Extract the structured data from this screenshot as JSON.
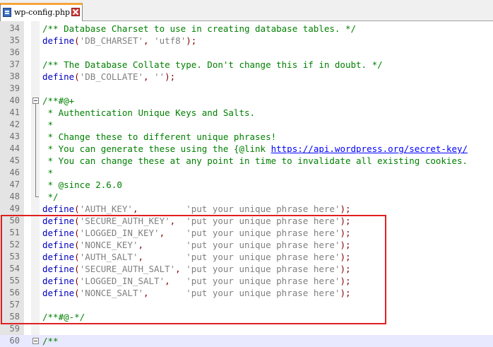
{
  "tab": {
    "filename": "wp-config.php"
  },
  "colors": {
    "highlight_box": "#e02020",
    "tab_accent": "#f6a43a"
  },
  "lines": [
    {
      "n": "34",
      "tokens": [
        {
          "t": "/** Database Charset to use in creating database tables. */",
          "c": "comment"
        }
      ]
    },
    {
      "n": "35",
      "tokens": [
        {
          "t": "define",
          "c": "kw"
        },
        {
          "t": "(",
          "c": "punc"
        },
        {
          "t": "'DB_CHARSET'",
          "c": "str"
        },
        {
          "t": ", ",
          "c": "punc"
        },
        {
          "t": "'utf8'",
          "c": "str"
        },
        {
          "t": ");",
          "c": "punc"
        }
      ]
    },
    {
      "n": "36",
      "tokens": []
    },
    {
      "n": "37",
      "tokens": [
        {
          "t": "/** The Database Collate type. Don't change this if in doubt. */",
          "c": "comment"
        }
      ]
    },
    {
      "n": "38",
      "tokens": [
        {
          "t": "define",
          "c": "kw"
        },
        {
          "t": "(",
          "c": "punc"
        },
        {
          "t": "'DB_COLLATE'",
          "c": "str"
        },
        {
          "t": ", ",
          "c": "punc"
        },
        {
          "t": "''",
          "c": "str"
        },
        {
          "t": ");",
          "c": "punc"
        }
      ]
    },
    {
      "n": "39",
      "tokens": []
    },
    {
      "n": "40",
      "tokens": [
        {
          "t": "/**#@+",
          "c": "comment"
        }
      ]
    },
    {
      "n": "41",
      "tokens": [
        {
          "t": " * Authentication Unique Keys and Salts.",
          "c": "comment"
        }
      ]
    },
    {
      "n": "42",
      "tokens": [
        {
          "t": " *",
          "c": "comment"
        }
      ]
    },
    {
      "n": "43",
      "tokens": [
        {
          "t": " * Change these to different unique phrases!",
          "c": "comment"
        }
      ]
    },
    {
      "n": "44",
      "tokens": [
        {
          "t": " * You can generate these using the {@link ",
          "c": "comment"
        },
        {
          "t": "https://api.wordpress.org/secret-key/",
          "c": "link"
        }
      ]
    },
    {
      "n": "45",
      "tokens": [
        {
          "t": " * You can change these at any point in time to invalidate all existing cookies.",
          "c": "comment"
        }
      ]
    },
    {
      "n": "46",
      "tokens": [
        {
          "t": " *",
          "c": "comment"
        }
      ]
    },
    {
      "n": "47",
      "tokens": [
        {
          "t": " * ",
          "c": "comment"
        },
        {
          "t": "@since",
          "c": "comment"
        },
        {
          "t": " 2.6.0",
          "c": "comment"
        }
      ]
    },
    {
      "n": "48",
      "tokens": [
        {
          "t": " */",
          "c": "comment"
        }
      ]
    },
    {
      "n": "49",
      "tokens": [
        {
          "t": "define",
          "c": "kw"
        },
        {
          "t": "(",
          "c": "punc"
        },
        {
          "t": "'AUTH_KEY'",
          "c": "str"
        },
        {
          "t": ",         ",
          "c": "punc"
        },
        {
          "t": "'put your unique phrase here'",
          "c": "str"
        },
        {
          "t": ");",
          "c": "punc"
        }
      ]
    },
    {
      "n": "50",
      "tokens": [
        {
          "t": "define",
          "c": "kw"
        },
        {
          "t": "(",
          "c": "punc"
        },
        {
          "t": "'SECURE_AUTH_KEY'",
          "c": "str"
        },
        {
          "t": ",  ",
          "c": "punc"
        },
        {
          "t": "'put your unique phrase here'",
          "c": "str"
        },
        {
          "t": ");",
          "c": "punc"
        }
      ]
    },
    {
      "n": "51",
      "tokens": [
        {
          "t": "define",
          "c": "kw"
        },
        {
          "t": "(",
          "c": "punc"
        },
        {
          "t": "'LOGGED_IN_KEY'",
          "c": "str"
        },
        {
          "t": ",    ",
          "c": "punc"
        },
        {
          "t": "'put your unique phrase here'",
          "c": "str"
        },
        {
          "t": ");",
          "c": "punc"
        }
      ]
    },
    {
      "n": "52",
      "tokens": [
        {
          "t": "define",
          "c": "kw"
        },
        {
          "t": "(",
          "c": "punc"
        },
        {
          "t": "'NONCE_KEY'",
          "c": "str"
        },
        {
          "t": ",        ",
          "c": "punc"
        },
        {
          "t": "'put your unique phrase here'",
          "c": "str"
        },
        {
          "t": ");",
          "c": "punc"
        }
      ]
    },
    {
      "n": "53",
      "tokens": [
        {
          "t": "define",
          "c": "kw"
        },
        {
          "t": "(",
          "c": "punc"
        },
        {
          "t": "'AUTH_SALT'",
          "c": "str"
        },
        {
          "t": ",        ",
          "c": "punc"
        },
        {
          "t": "'put your unique phrase here'",
          "c": "str"
        },
        {
          "t": ");",
          "c": "punc"
        }
      ]
    },
    {
      "n": "54",
      "tokens": [
        {
          "t": "define",
          "c": "kw"
        },
        {
          "t": "(",
          "c": "punc"
        },
        {
          "t": "'SECURE_AUTH_SALT'",
          "c": "str"
        },
        {
          "t": ", ",
          "c": "punc"
        },
        {
          "t": "'put your unique phrase here'",
          "c": "str"
        },
        {
          "t": ");",
          "c": "punc"
        }
      ]
    },
    {
      "n": "55",
      "tokens": [
        {
          "t": "define",
          "c": "kw"
        },
        {
          "t": "(",
          "c": "punc"
        },
        {
          "t": "'LOGGED_IN_SALT'",
          "c": "str"
        },
        {
          "t": ",   ",
          "c": "punc"
        },
        {
          "t": "'put your unique phrase here'",
          "c": "str"
        },
        {
          "t": ");",
          "c": "punc"
        }
      ]
    },
    {
      "n": "56",
      "tokens": [
        {
          "t": "define",
          "c": "kw"
        },
        {
          "t": "(",
          "c": "punc"
        },
        {
          "t": "'NONCE_SALT'",
          "c": "str"
        },
        {
          "t": ",       ",
          "c": "punc"
        },
        {
          "t": "'put your unique phrase here'",
          "c": "str"
        },
        {
          "t": ");",
          "c": "punc"
        }
      ]
    },
    {
      "n": "57",
      "tokens": []
    },
    {
      "n": "58",
      "tokens": [
        {
          "t": "/**#@-*/",
          "c": "comment"
        }
      ]
    },
    {
      "n": "59",
      "tokens": []
    },
    {
      "n": "60",
      "tokens": [
        {
          "t": "/**",
          "c": "comment"
        }
      ]
    }
  ]
}
